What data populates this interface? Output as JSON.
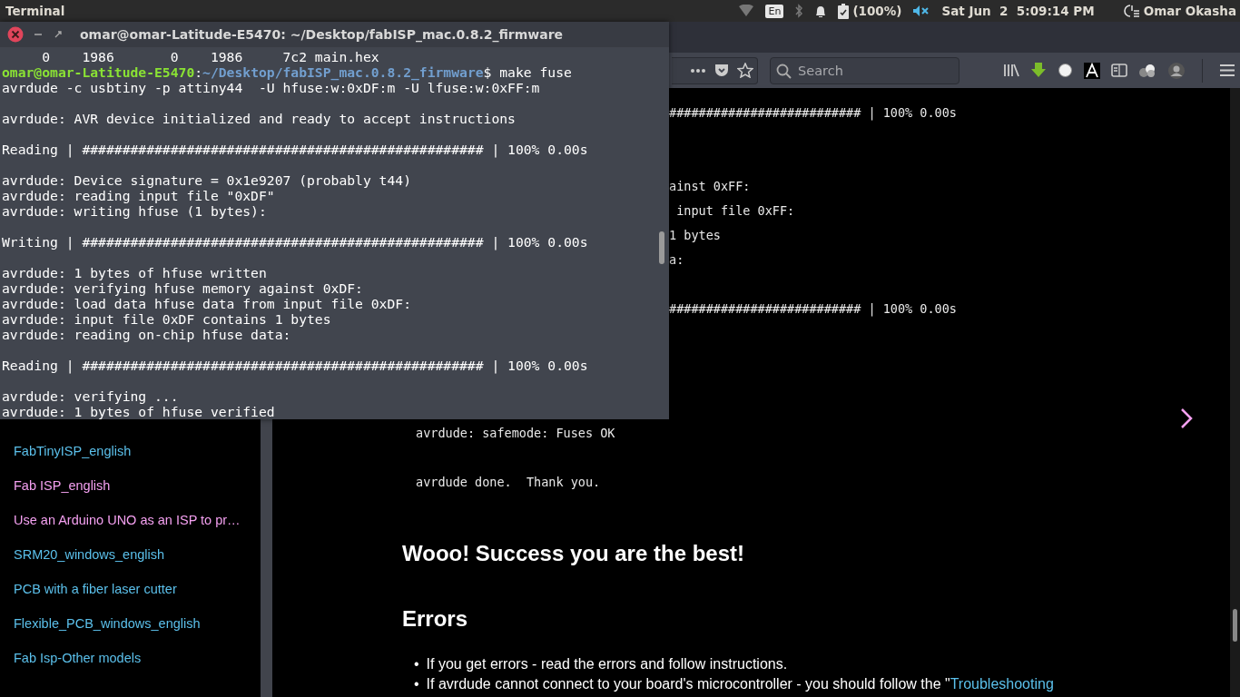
{
  "top_bar": {
    "app_name": "Terminal",
    "keyboard": "En",
    "battery": "(100%)",
    "datetime": "Sat Jun  2  5:09:14 PM",
    "user": "Omar Okasha"
  },
  "browser": {
    "toolbar": {
      "search_placeholder": "Search"
    },
    "sidebar": {
      "items": [
        {
          "label": "FabTinyISP_english",
          "color": "#5bc0eb"
        },
        {
          "label": "Fab ISP_english",
          "color": "#f4a0f0"
        },
        {
          "label": "Use an Arduino UNO as an ISP to pr…",
          "color": "#f4a0f0"
        },
        {
          "label": "SRM20_windows_english",
          "color": "#5bc0eb"
        },
        {
          "label": "PCB with a fiber laser cutter",
          "color": "#5bc0eb"
        },
        {
          "label": "Flexible_PCB_windows_english",
          "color": "#5bc0eb"
        },
        {
          "label": "Fab Isp-Other models",
          "color": "#5bc0eb"
        }
      ]
    },
    "content": {
      "output_top": [
        {
          "kind": "text",
          "text": "########################## | 100% 0.00s"
        },
        {
          "kind": "gap"
        },
        {
          "kind": "gap"
        },
        {
          "kind": "text",
          "text": "ainst 0xFF:"
        },
        {
          "kind": "text",
          "text": " input file 0xFF:"
        },
        {
          "kind": "text",
          "text": "1 bytes"
        },
        {
          "kind": "text",
          "text": "a:"
        },
        {
          "kind": "gap"
        },
        {
          "kind": "text",
          "text": "########################## | 100% 0.00s"
        }
      ],
      "output_bottom": [
        {
          "kind": "text",
          "text": "avrdude: safemode: Fuses OK"
        },
        {
          "kind": "gap"
        },
        {
          "kind": "text",
          "text": "avrdude done.  Thank you."
        }
      ],
      "heading": "Wooo! Success you are the best!",
      "section": "Errors",
      "bullets": [
        {
          "marker": "•",
          "text": "If you get errors - read the errors and follow instructions."
        },
        {
          "marker": "•",
          "text": "If avrdude cannot connect to your board's microcontroller - you should follow the \"",
          "link": "Troubleshooting"
        }
      ]
    }
  },
  "terminal": {
    "title": "omar@omar-Latitude-E5470: ~/Desktop/fabISP_mac.0.8.2_firmware",
    "lines": [
      {
        "kind": "text",
        "text": "     0    1986       0    1986     7c2 main.hex"
      },
      {
        "kind": "prompt",
        "user": "omar@omar-Latitude-E5470",
        "sep": ":",
        "path": "~/Desktop/fabISP_mac.0.8.2_firmware",
        "command": "$ make fuse"
      },
      {
        "kind": "text",
        "text": "avrdude -c usbtiny -p attiny44  -U hfuse:w:0xDF:m -U lfuse:w:0xFF:m"
      },
      {
        "kind": "gap"
      },
      {
        "kind": "text",
        "text": "avrdude: AVR device initialized and ready to accept instructions"
      },
      {
        "kind": "gap"
      },
      {
        "kind": "text",
        "text": "Reading | ################################################## | 100% 0.00s"
      },
      {
        "kind": "gap"
      },
      {
        "kind": "text",
        "text": "avrdude: Device signature = 0x1e9207 (probably t44)"
      },
      {
        "kind": "text",
        "text": "avrdude: reading input file \"0xDF\""
      },
      {
        "kind": "text",
        "text": "avrdude: writing hfuse (1 bytes):"
      },
      {
        "kind": "gap"
      },
      {
        "kind": "text",
        "text": "Writing | ################################################## | 100% 0.00s"
      },
      {
        "kind": "gap"
      },
      {
        "kind": "text",
        "text": "avrdude: 1 bytes of hfuse written"
      },
      {
        "kind": "text",
        "text": "avrdude: verifying hfuse memory against 0xDF:"
      },
      {
        "kind": "text",
        "text": "avrdude: load data hfuse data from input file 0xDF:"
      },
      {
        "kind": "text",
        "text": "avrdude: input file 0xDF contains 1 bytes"
      },
      {
        "kind": "text",
        "text": "avrdude: reading on-chip hfuse data:"
      },
      {
        "kind": "gap"
      },
      {
        "kind": "text",
        "text": "Reading | ################################################## | 100% 0.00s"
      },
      {
        "kind": "gap"
      },
      {
        "kind": "text",
        "text": "avrdude: verifying ..."
      },
      {
        "kind": "text",
        "text": "avrdude: 1 bytes of hfuse verified"
      }
    ]
  }
}
